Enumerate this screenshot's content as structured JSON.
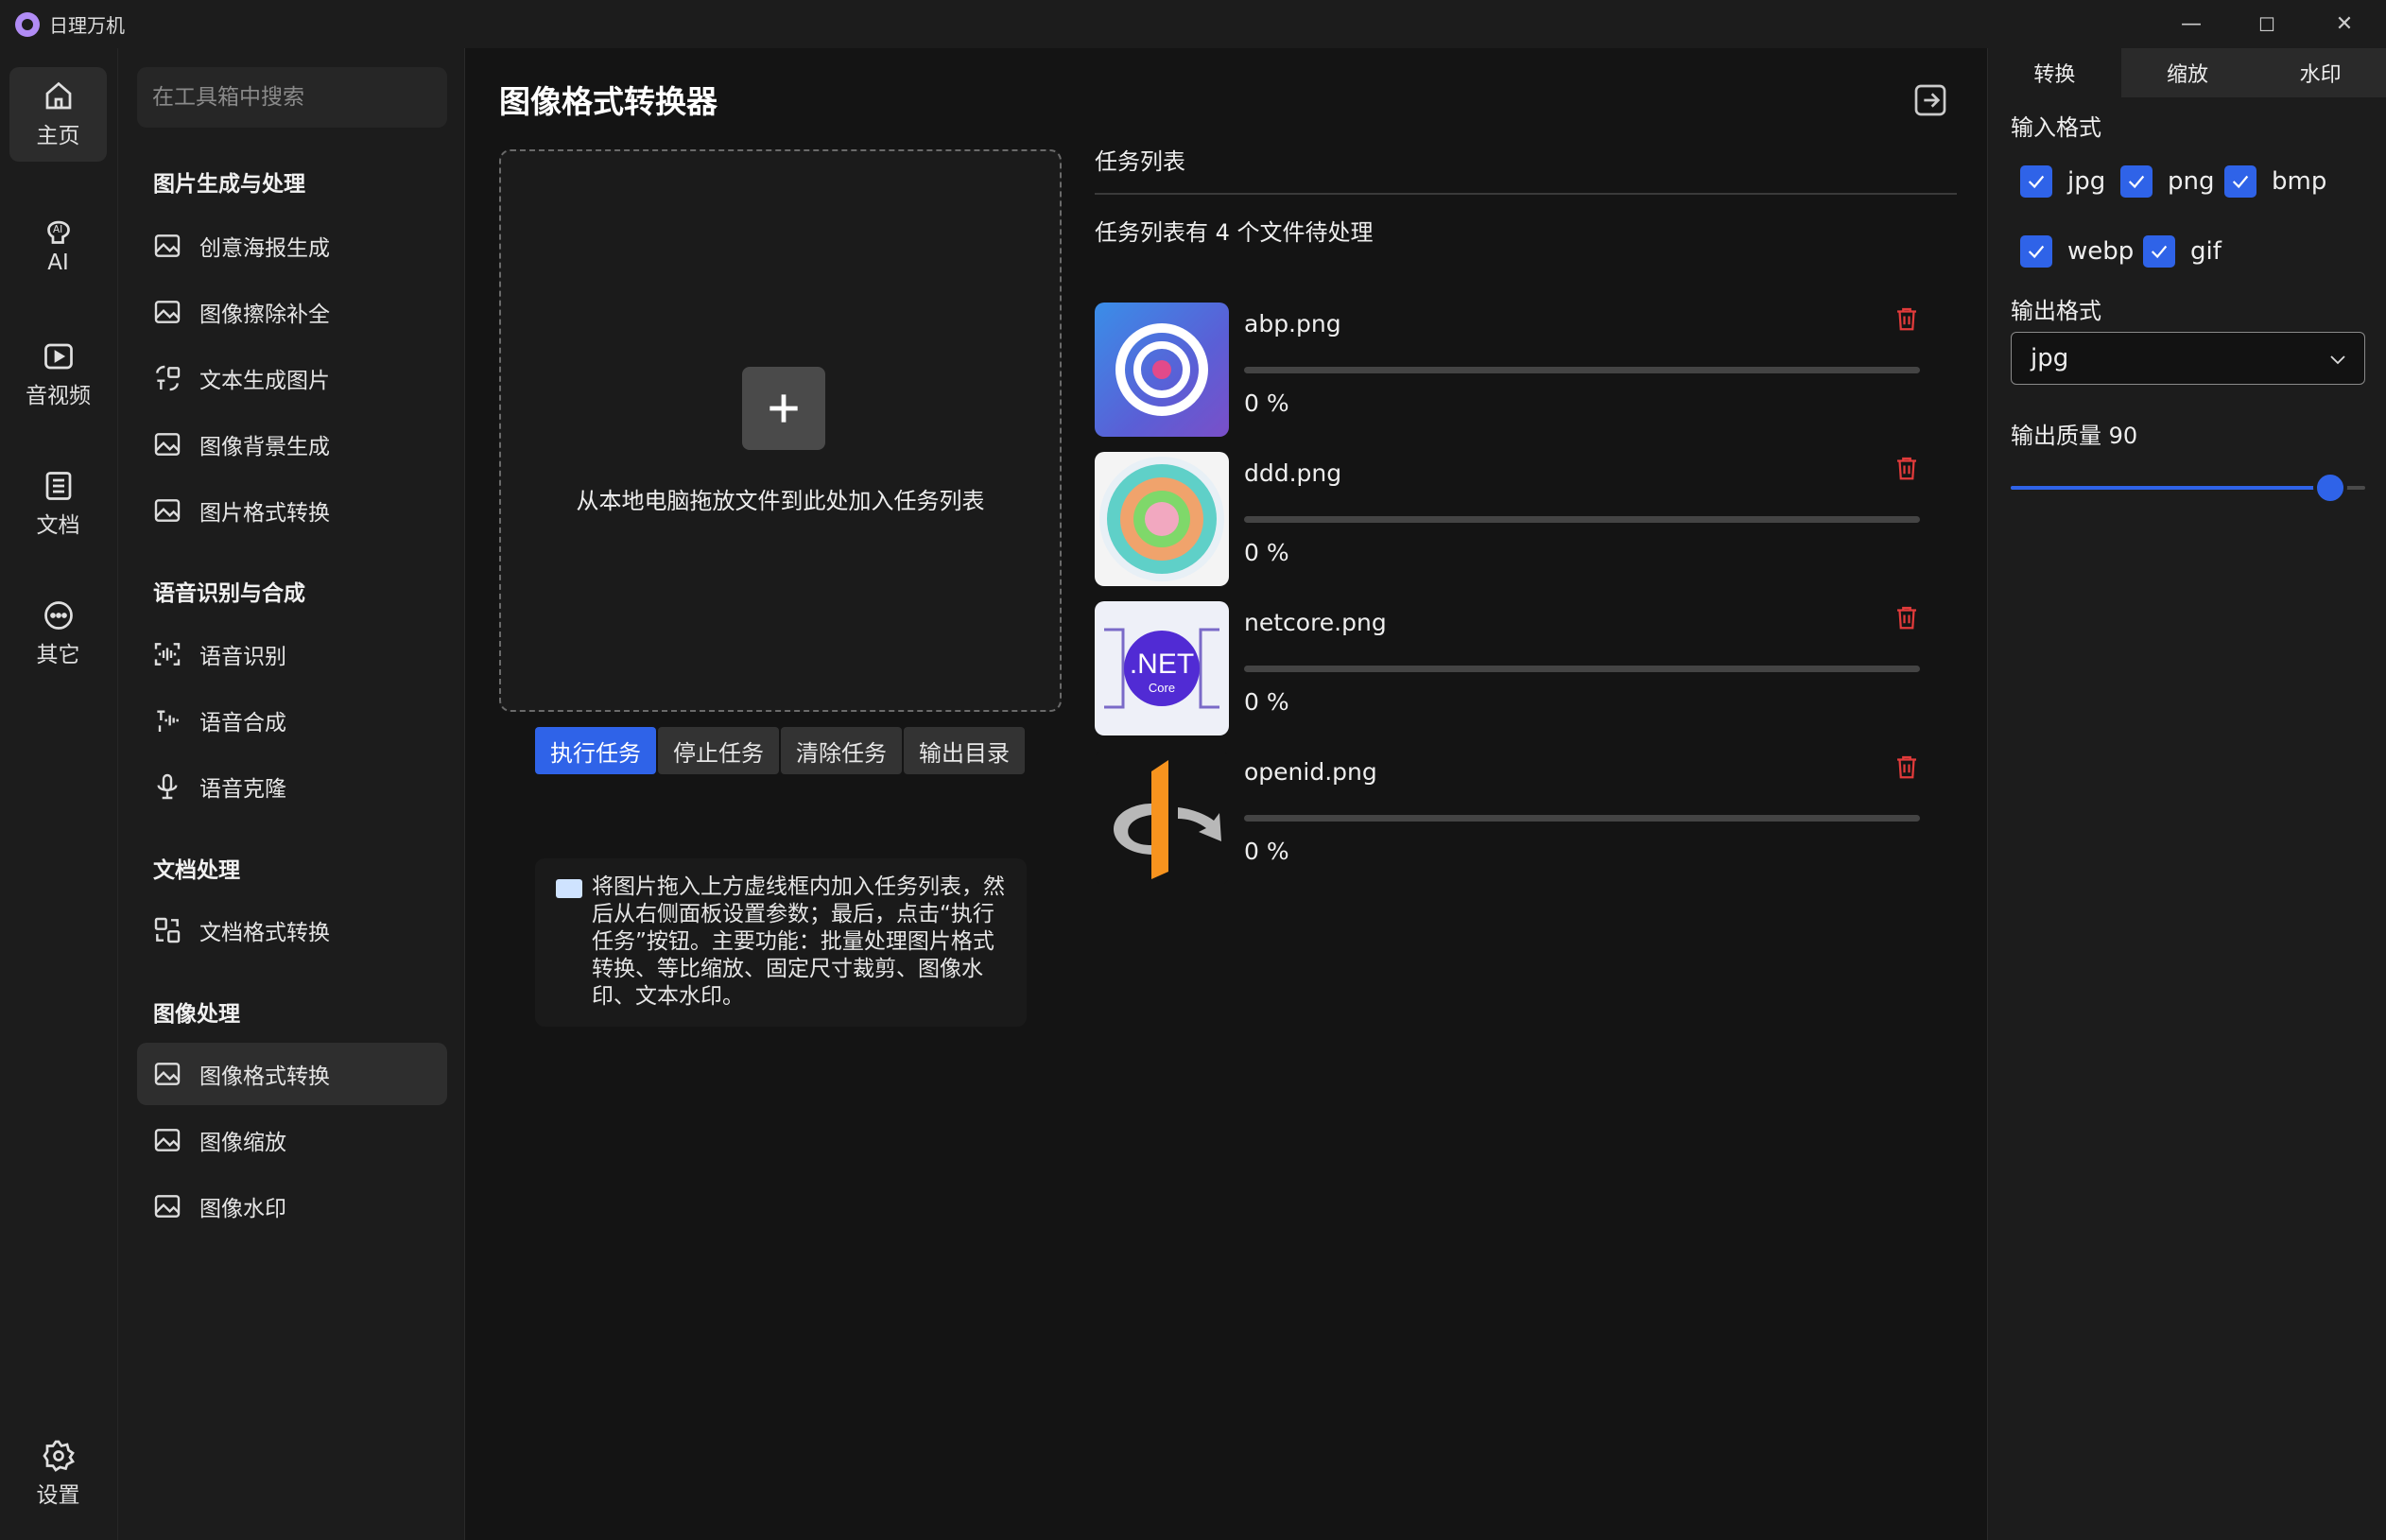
{
  "window": {
    "title": "日理万机",
    "minimize": "—",
    "maximize": "☐",
    "close": "✕"
  },
  "rail": {
    "home": "主页",
    "ai": "AI",
    "media": "音视频",
    "docs": "文档",
    "other": "其它",
    "settings": "设置"
  },
  "nav": {
    "search_placeholder": "在工具箱中搜索",
    "sections": [
      {
        "title": "图片生成与处理",
        "items": [
          "创意海报生成",
          "图像擦除补全",
          "文本生成图片",
          "图像背景生成",
          "图片格式转换"
        ]
      },
      {
        "title": "语音识别与合成",
        "items": [
          "语音识别",
          "语音合成",
          "语音克隆"
        ]
      },
      {
        "title": "文档处理",
        "items": [
          "文档格式转换"
        ]
      },
      {
        "title": "图像处理",
        "items": [
          "图像格式转换",
          "图像缩放",
          "图像水印"
        ]
      }
    ]
  },
  "main": {
    "title": "图像格式转换器",
    "drop_text": "从本地电脑拖放文件到此处加入任务列表",
    "buttons": {
      "run": "执行任务",
      "stop": "停止任务",
      "clear": "清除任务",
      "output": "输出目录"
    },
    "help": "将图片拖入上方虚线框内加入任务列表，然后从右侧面板设置参数；最后，点击“执行任务”按钮。主要功能：批量处理图片格式转换、等比缩放、固定尺寸裁剪、图像水印、文本水印。",
    "task_list_title": "任务列表",
    "task_count": "任务列表有 4 个文件待处理",
    "tasks": [
      {
        "name": "abp.png",
        "progress": "0 %"
      },
      {
        "name": "ddd.png",
        "progress": "0 %"
      },
      {
        "name": "netcore.png",
        "progress": "0 %",
        "thumb_text": ".NET",
        "thumb_sub": "Core"
      },
      {
        "name": "openid.png",
        "progress": "0 %"
      }
    ]
  },
  "side": {
    "tabs": [
      "转换",
      "缩放",
      "水印"
    ],
    "input_format_label": "输入格式",
    "input_formats": [
      "jpg",
      "png",
      "bmp",
      "webp",
      "gif"
    ],
    "output_format_label": "输出格式",
    "output_format": "jpg",
    "quality_label": "输出质量 90",
    "quality": 90
  },
  "colors": {
    "accent": "#2f63e8",
    "danger": "#e23b3b"
  }
}
